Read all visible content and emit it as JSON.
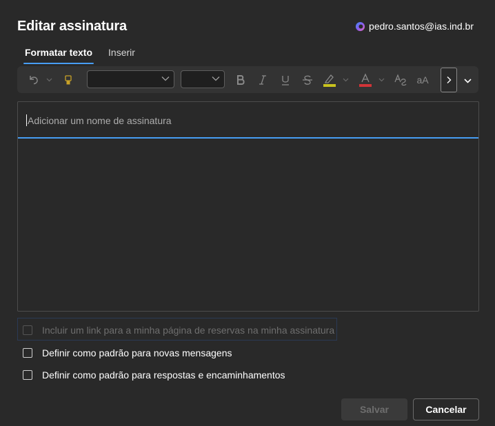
{
  "dialog": {
    "title": "Editar assinatura",
    "account_email": "pedro.santos@ias.ind.br"
  },
  "tabs": [
    {
      "label": "Formatar texto",
      "active": true
    },
    {
      "label": "Inserir",
      "active": false
    }
  ],
  "toolbar": {
    "font_family_value": "",
    "font_size_value": "",
    "case_label": "aA",
    "highlight_color": "#c8c21e",
    "font_color": "#d13438"
  },
  "signature": {
    "name_placeholder": "Adicionar um nome de assinatura",
    "name_value": "",
    "body": ""
  },
  "options": [
    {
      "label": "Incluir um link para a minha página de reservas na minha assinatura",
      "checked": false,
      "disabled": true
    },
    {
      "label": "Definir como padrão para novas mensagens",
      "checked": false,
      "disabled": false
    },
    {
      "label": "Definir como padrão para respostas e encaminhamentos",
      "checked": false,
      "disabled": false
    }
  ],
  "buttons": {
    "save": "Salvar",
    "cancel": "Cancelar"
  }
}
